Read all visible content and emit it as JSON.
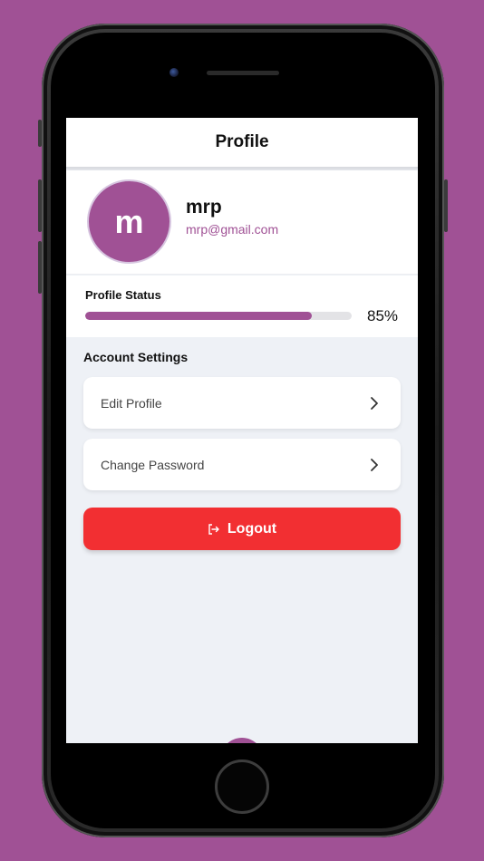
{
  "header": {
    "title": "Profile"
  },
  "profile": {
    "avatar_letter": "m",
    "name": "mrp",
    "email": "mrp@gmail.com"
  },
  "status": {
    "label": "Profile Status",
    "progress_fraction": 0.85,
    "percent_text": "85%"
  },
  "settings": {
    "section_title": "Account Settings",
    "items": [
      {
        "label": "Edit Profile",
        "icon": "chevron-right-icon"
      },
      {
        "label": "Change Password",
        "icon": "chevron-right-icon"
      }
    ]
  },
  "logout": {
    "label": "Logout",
    "icon": "logout-icon"
  },
  "colors": {
    "brand": "#a05195",
    "danger": "#f22f32",
    "background": "#eef1f6"
  }
}
